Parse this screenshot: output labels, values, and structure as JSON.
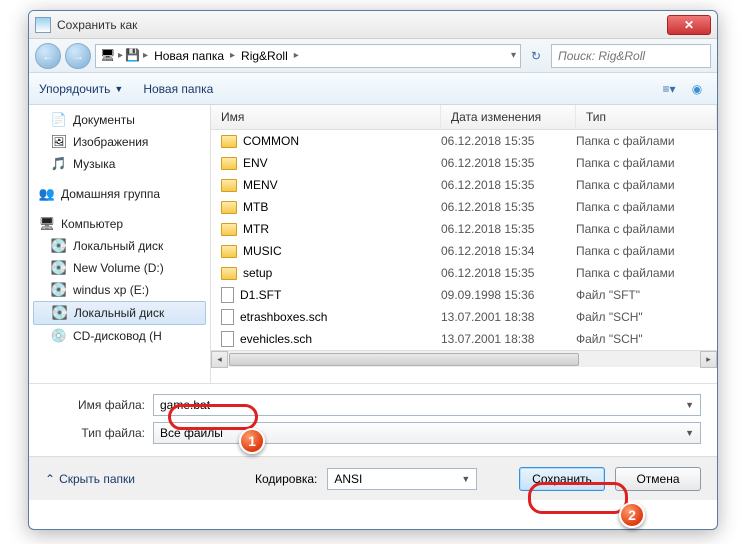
{
  "window": {
    "title": "Сохранить как"
  },
  "breadcrumb": {
    "seg1": "Новая папка",
    "seg2": "Rig&Roll"
  },
  "search": {
    "placeholder": "Поиск: Rig&Roll"
  },
  "toolbar": {
    "organize": "Упорядочить",
    "new_folder": "Новая папка"
  },
  "sidebar": {
    "docs": "Документы",
    "images": "Изображения",
    "music": "Музыка",
    "homegroup": "Домашняя группа",
    "computer": "Компьютер",
    "localdisk1": "Локальный диск",
    "vol_d": "New Volume (D:)",
    "winxp": "windus xp (E:)",
    "localdisk2": "Локальный диск",
    "cdrom": "CD-дисковод (H"
  },
  "columns": {
    "name": "Имя",
    "date": "Дата изменения",
    "type": "Тип"
  },
  "files": [
    {
      "name": "COMMON",
      "date": "06.12.2018 15:35",
      "type": "Папка с файлами",
      "kind": "folder"
    },
    {
      "name": "ENV",
      "date": "06.12.2018 15:35",
      "type": "Папка с файлами",
      "kind": "folder"
    },
    {
      "name": "MENV",
      "date": "06.12.2018 15:35",
      "type": "Папка с файлами",
      "kind": "folder"
    },
    {
      "name": "MTB",
      "date": "06.12.2018 15:35",
      "type": "Папка с файлами",
      "kind": "folder"
    },
    {
      "name": "MTR",
      "date": "06.12.2018 15:35",
      "type": "Папка с файлами",
      "kind": "folder"
    },
    {
      "name": "MUSIC",
      "date": "06.12.2018 15:34",
      "type": "Папка с файлами",
      "kind": "folder"
    },
    {
      "name": "setup",
      "date": "06.12.2018 15:35",
      "type": "Папка с файлами",
      "kind": "folder"
    },
    {
      "name": "D1.SFT",
      "date": "09.09.1998 15:36",
      "type": "Файл \"SFT\"",
      "kind": "file"
    },
    {
      "name": "etrashboxes.sch",
      "date": "13.07.2001 18:38",
      "type": "Файл \"SCH\"",
      "kind": "file"
    },
    {
      "name": "evehicles.sch",
      "date": "13.07.2001 18:38",
      "type": "Файл \"SCH\"",
      "kind": "file"
    }
  ],
  "form": {
    "filename_label": "Имя файла:",
    "filename_value": "game.bat",
    "filetype_label": "Тип файла:",
    "filetype_value": "Все файлы"
  },
  "footer": {
    "hide_folders": "Скрыть папки",
    "encoding_label": "Кодировка:",
    "encoding_value": "ANSI",
    "save": "Сохранить",
    "cancel": "Отмена"
  },
  "annotations": {
    "b1": "1",
    "b2": "2"
  }
}
